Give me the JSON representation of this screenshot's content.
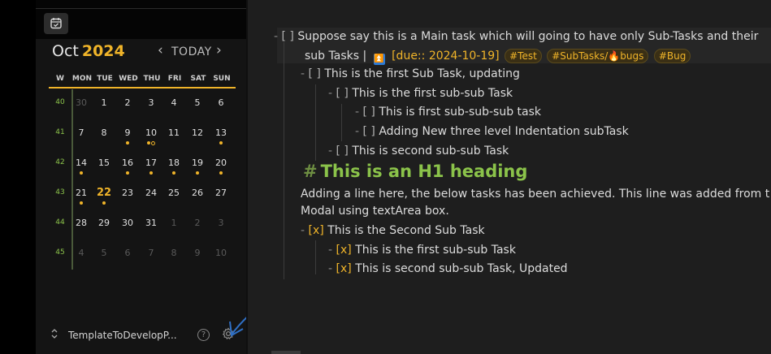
{
  "calendar": {
    "month": "Oct",
    "year": "2024",
    "nav": {
      "prev": "‹",
      "today": "TODAY",
      "next": "›"
    },
    "headers": [
      "W",
      "MON",
      "TUE",
      "WED",
      "THU",
      "FRI",
      "SAT",
      "SUN"
    ],
    "weeks": [
      {
        "wk": "40",
        "days": [
          "30",
          "1",
          "2",
          "3",
          "4",
          "5",
          "6"
        ]
      },
      {
        "wk": "41",
        "days": [
          "7",
          "8",
          "9",
          "10",
          "11",
          "12",
          "13"
        ]
      },
      {
        "wk": "42",
        "days": [
          "14",
          "15",
          "16",
          "17",
          "18",
          "19",
          "20"
        ]
      },
      {
        "wk": "43",
        "days": [
          "21",
          "22",
          "23",
          "24",
          "25",
          "26",
          "27"
        ]
      },
      {
        "wk": "44",
        "days": [
          "28",
          "29",
          "30",
          "31",
          "1",
          "2",
          "3"
        ]
      },
      {
        "wk": "45",
        "days": [
          "4",
          "5",
          "6",
          "7",
          "8",
          "9",
          "10"
        ]
      }
    ],
    "accent": "#f0b429"
  },
  "vault": {
    "arrows": "⌃⌄",
    "name": "TemplateToDevelopP...",
    "help": "?"
  },
  "editor": {
    "lines": [
      {
        "text": "Suppose say this  is a Main task which will going to have only Sub-Tasks and their"
      },
      {
        "text": "sub Tasks |"
      },
      {
        "text": "This is the first Sub Task, updating"
      },
      {
        "text": "This is the first sub-sub Task"
      },
      {
        "text": "This is first sub-sub-sub task"
      },
      {
        "text": "Adding New three level Indentation subTask"
      },
      {
        "text": "This is second sub-sub Task"
      },
      {
        "text": "Adding a line here, the below tasks has been achieved. This line was added from t"
      },
      {
        "text": "Modal using textArea box."
      },
      {
        "text": "This is the Second Sub Task"
      },
      {
        "text": "This is the first sub-sub Task"
      },
      {
        "text": "This is second sub-sub Task, Updated"
      }
    ],
    "due": "[due:: 2024-10-19]",
    "priority_icon": "⏫",
    "tags": [
      "#Test",
      "#SubTasks/🔥bugs",
      "#Bug"
    ],
    "heading_hash": "#",
    "heading": "This is an H1 heading",
    "bullet": "-",
    "unchecked": "[ ]",
    "checked": "[x]"
  }
}
